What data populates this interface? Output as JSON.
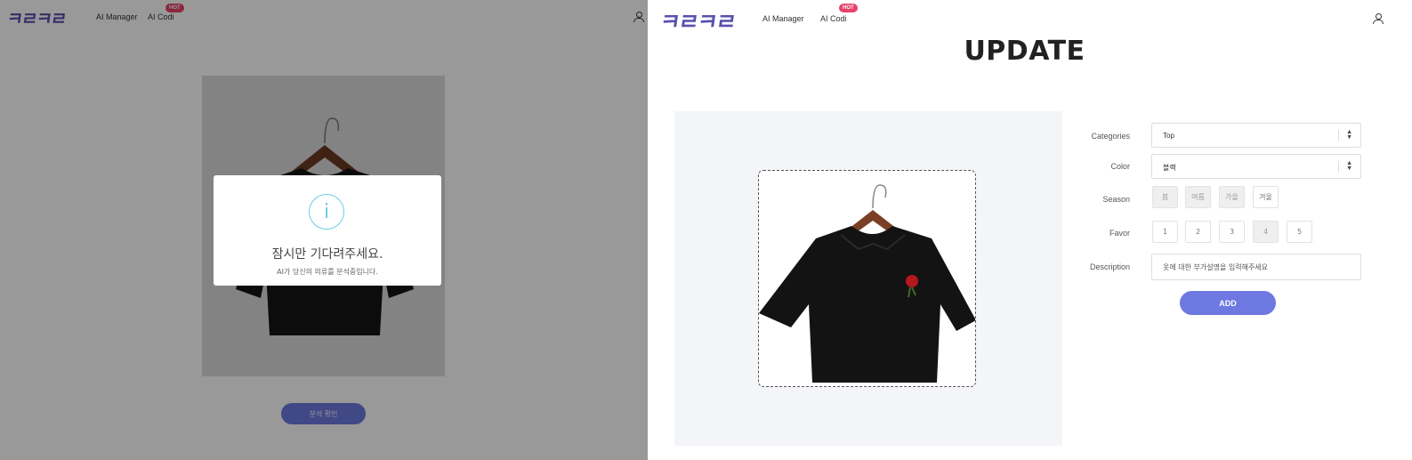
{
  "left": {
    "logo": "ㅋㄹㅋㄹ",
    "nav": {
      "ai_manager": "AI Manager",
      "ai_codi": "AI Codi",
      "hot_badge": "HOT"
    },
    "analyze_button": "분석 확인",
    "modal": {
      "icon": "info-icon",
      "title": "잠시만 기다려주세요.",
      "subtitle": "AI가 당신의 의류를 분석중입니다."
    }
  },
  "right": {
    "logo": "ㅋㄹㅋㄹ",
    "nav": {
      "ai_manager": "AI Manager",
      "ai_codi": "AI Codi",
      "hot_badge": "HOT"
    },
    "page_title": "UPDATE",
    "form": {
      "categories_label": "Categories",
      "categories_value": "Top",
      "color_label": "Color",
      "color_value": "블랙",
      "season_label": "Season",
      "seasons": [
        "봄",
        "여름",
        "가을",
        "겨울"
      ],
      "seasons_selected": [
        "봄",
        "여름",
        "가을"
      ],
      "favor_label": "Favor",
      "favor_options": [
        "1",
        "2",
        "3",
        "4",
        "5"
      ],
      "favor_selected": "4",
      "description_label": "Description",
      "description_placeholder": "옷에 대한 부가설명을 입력해주세요",
      "add_button": "ADD"
    }
  },
  "colors": {
    "brand": "#5a4fae",
    "accent": "#6d78e0",
    "hot": "#e8416b",
    "info": "#6ccbe5"
  }
}
